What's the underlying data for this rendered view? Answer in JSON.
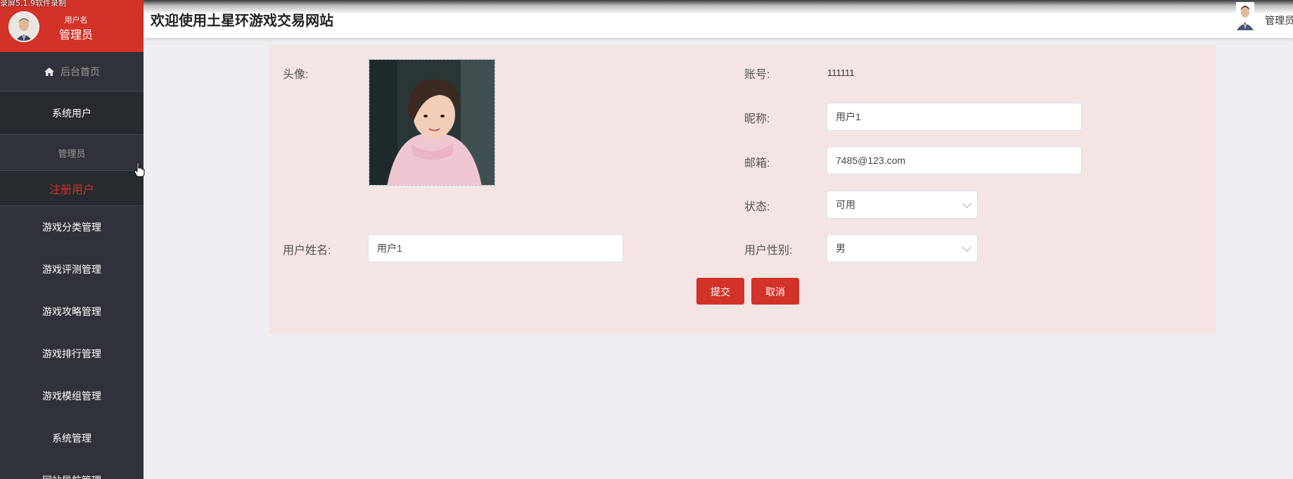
{
  "watermark": "录屏5.1.9软件录制",
  "header": {
    "title": "欢迎使用土星环游戏交易网站",
    "user": "管理员"
  },
  "sidebar": {
    "user_label": "用户名",
    "user_name": "管理员",
    "home": "后台首页",
    "items": [
      {
        "label": "系统用户"
      },
      {
        "label": "管理员"
      },
      {
        "label": "注册用户"
      },
      {
        "label": "游戏分类管理"
      },
      {
        "label": "游戏评测管理"
      },
      {
        "label": "游戏攻略管理"
      },
      {
        "label": "游戏排行管理"
      },
      {
        "label": "游戏模组管理"
      },
      {
        "label": "系统管理"
      },
      {
        "label": "网站导航管理"
      }
    ],
    "active_color": "#d23228"
  },
  "form": {
    "avatar_label": "头像:",
    "account_label": "账号:",
    "account_value": "111111",
    "nickname_label": "昵称:",
    "nickname_value": "用户1",
    "email_label": "邮箱:",
    "email_value": "7485@123.com",
    "status_label": "状态:",
    "status_value": "可用",
    "realname_label": "用户姓名:",
    "realname_value": "用户1",
    "gender_label": "用户性别:",
    "gender_value": "男",
    "submit": "提交",
    "cancel": "取消"
  },
  "colors": {
    "brand_red": "#d23228",
    "sidebar_bg": "#2f3238",
    "panel_bg": "#f4e4e3"
  }
}
